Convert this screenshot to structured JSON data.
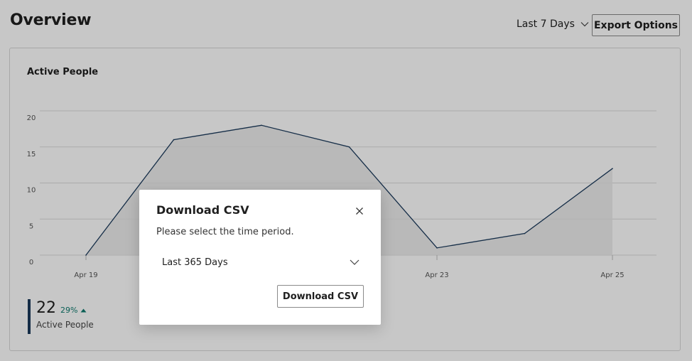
{
  "header": {
    "title": "Overview",
    "range_label": "Last 7 Days",
    "export_label": "Export Options"
  },
  "card": {
    "title": "Active People"
  },
  "chart_data": {
    "type": "area",
    "title": "Active People",
    "xlabel": "",
    "ylabel": "",
    "x": [
      0,
      1,
      2,
      3,
      4,
      5,
      6
    ],
    "x_tick_positions": [
      0,
      2,
      4,
      6
    ],
    "x_tick_labels": [
      "Apr 19",
      "Apr 21",
      "Apr 23",
      "Apr 25"
    ],
    "y_ticks": [
      0,
      5,
      10,
      15,
      20
    ],
    "ylim": [
      0,
      20
    ],
    "series": [
      {
        "values": [
          0,
          16,
          18,
          15,
          1,
          3,
          12
        ]
      }
    ],
    "grid": true,
    "line_color": "#1b3a5c"
  },
  "kpi": {
    "value": "22",
    "delta": "29%",
    "label": "Active People",
    "accent_color": "#1b3a5c",
    "delta_color": "#0e7a6e"
  },
  "dialog": {
    "title": "Download CSV",
    "description": "Please select the time period.",
    "selected_period": "Last 365 Days",
    "download_label": "Download CSV"
  }
}
